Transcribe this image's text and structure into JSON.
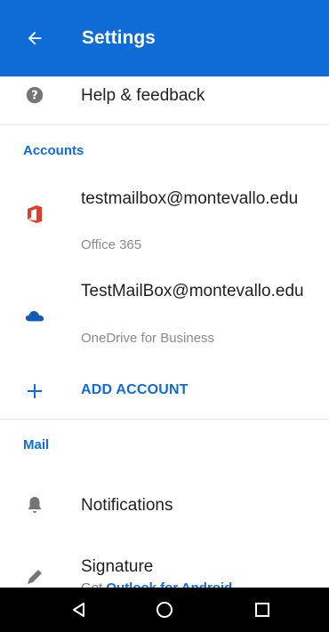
{
  "appbar": {
    "title": "Settings",
    "back_icon": "arrow-back-icon",
    "background": "#0f6cd6"
  },
  "help": {
    "label": "Help & feedback",
    "icon": "help-circle-icon"
  },
  "accounts": {
    "header": "Accounts",
    "items": [
      {
        "name": "testmailbox@montevallo.edu",
        "type": "Office 365",
        "icon": "office-365-icon",
        "icon_color": "#e43c2b"
      },
      {
        "name": "TestMailBox@montevallo.edu",
        "type": "OneDrive for Business",
        "icon": "onedrive-cloud-icon",
        "icon_color": "#0f5cb8"
      }
    ],
    "add_label": "ADD ACCOUNT",
    "add_icon": "plus-icon"
  },
  "mail": {
    "header": "Mail",
    "notifications_label": "Notifications",
    "notifications_icon": "bell-icon",
    "signature_label": "Signature",
    "signature_icon": "pen-icon",
    "signature_hint_prefix": "Get",
    "signature_hint_link": "Outlook for Android"
  },
  "navbar": {
    "back_icon": "nav-back-triangle-icon",
    "home_icon": "nav-home-circle-icon",
    "recents_icon": "nav-recents-square-icon"
  },
  "colors": {
    "accent": "#0f6cd6",
    "text_primary": "#212121",
    "text_secondary": "#8a8a8a",
    "icon_gray": "#757575"
  }
}
